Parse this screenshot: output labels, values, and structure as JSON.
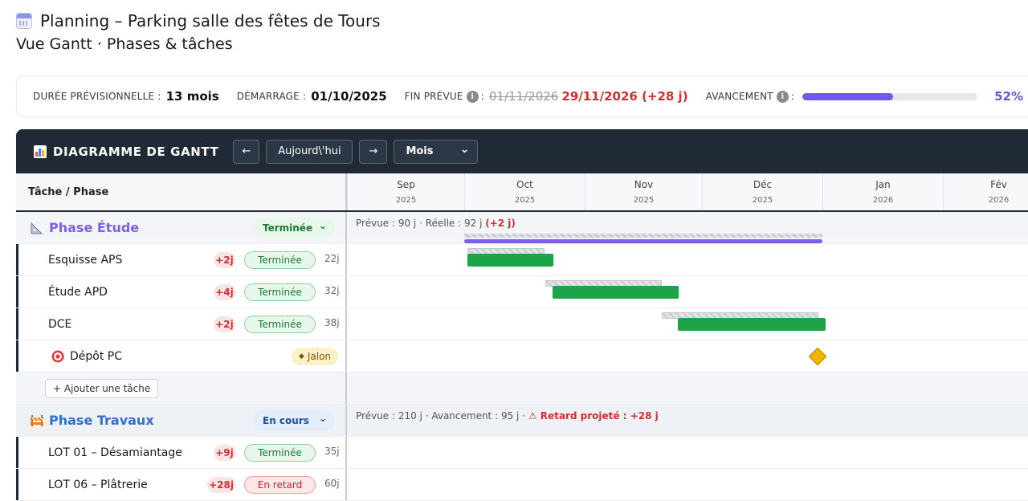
{
  "header": {
    "title": "Planning – Parking salle des fêtes de Tours",
    "subtitle": "Vue Gantt · Phases & tâches"
  },
  "summary": {
    "duration_label": "DURÉE PRÉVISIONNELLE :",
    "duration_value": "13 mois",
    "start_label": "DÉMARRAGE :",
    "start_value": "01/10/2025",
    "end_label": "FIN PRÉVUE",
    "end_colon": ":",
    "end_old": "01/11/2026",
    "end_new": "29/11/2026 (+28 j)",
    "progress_label": "AVANCEMENT",
    "progress_colon": ":",
    "progress_value": 0.52,
    "progress_text": "52%",
    "info_glyph": "i"
  },
  "toolbar": {
    "title": "DIAGRAMME DE GANTT",
    "prev": "←",
    "today": "Aujourd\\'hui",
    "next": "→",
    "scale": "Mois",
    "scale_chevron": "⌄"
  },
  "columns": {
    "task_header": "Tâche / Phase",
    "months": [
      {
        "m": "Sep",
        "y": "2025"
      },
      {
        "m": "Oct",
        "y": "2025"
      },
      {
        "m": "Nov",
        "y": "2025"
      },
      {
        "m": "Déc",
        "y": "2025"
      },
      {
        "m": "Jan",
        "y": "2026"
      },
      {
        "m": "Fév",
        "y": "2026"
      }
    ]
  },
  "phase1": {
    "name": "Phase Étude",
    "status": "Terminée",
    "chevron": "⌄",
    "summary_a": "Prévue : 90 j · Réelle : 92 j ",
    "summary_b": "(+2 j)"
  },
  "tasks1": [
    {
      "name": "Esquisse APS",
      "delta": "+2j",
      "status": "Terminée",
      "duration": "22j"
    },
    {
      "name": "Étude APD",
      "delta": "+4j",
      "status": "Terminée",
      "duration": "32j"
    },
    {
      "name": "DCE",
      "delta": "+2j",
      "status": "Terminée",
      "duration": "38j"
    }
  ],
  "milestone": {
    "name": "Dépôt PC",
    "tag": "Jalon",
    "tag_glyph": "◆"
  },
  "add_task": "+ Ajouter une tâche",
  "phase2": {
    "name": "Phase Travaux",
    "status": "En cours",
    "chevron": "⌄",
    "summary_a": "Prévue : 210 j · Avancement : 95 j · ",
    "summary_b": "⚠ Retard projeté : +28 j"
  },
  "tasks2": [
    {
      "name": "LOT 01 – Désamiantage",
      "delta": "+9j",
      "status": "Terminée",
      "duration": "35j"
    },
    {
      "name": "LOT 06 – Plâtrerie",
      "delta": "+28j",
      "status": "En retard",
      "duration": "60j"
    }
  ],
  "colors": {
    "accent": "#6c5ce7",
    "done_green": "#1ea34b",
    "late_red": "#d32f2f",
    "toolbar_bg": "#1f2a36",
    "milestone_gold": "#f2b400"
  }
}
